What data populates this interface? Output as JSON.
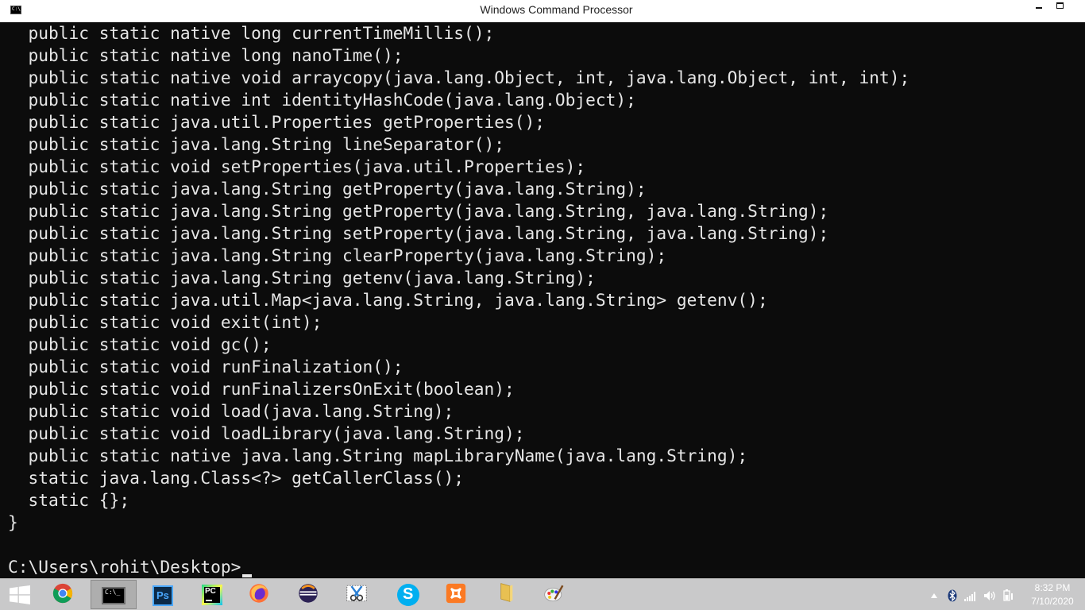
{
  "window": {
    "title": "Windows Command Processor",
    "app_icon_text": "C:\\"
  },
  "console": {
    "lines": [
      "  public static native long currentTimeMillis();",
      "  public static native long nanoTime();",
      "  public static native void arraycopy(java.lang.Object, int, java.lang.Object, int, int);",
      "  public static native int identityHashCode(java.lang.Object);",
      "  public static java.util.Properties getProperties();",
      "  public static java.lang.String lineSeparator();",
      "  public static void setProperties(java.util.Properties);",
      "  public static java.lang.String getProperty(java.lang.String);",
      "  public static java.lang.String getProperty(java.lang.String, java.lang.String);",
      "  public static java.lang.String setProperty(java.lang.String, java.lang.String);",
      "  public static java.lang.String clearProperty(java.lang.String);",
      "  public static java.lang.String getenv(java.lang.String);",
      "  public static java.util.Map<java.lang.String, java.lang.String> getenv();",
      "  public static void exit(int);",
      "  public static void gc();",
      "  public static void runFinalization();",
      "  public static void runFinalizersOnExit(boolean);",
      "  public static void load(java.lang.String);",
      "  public static void loadLibrary(java.lang.String);",
      "  public static native java.lang.String mapLibraryName(java.lang.String);",
      "  static java.lang.Class<?> getCallerClass();",
      "  static {};",
      "}",
      ""
    ],
    "prompt": "C:\\Users\\rohit\\Desktop>"
  },
  "taskbar": {
    "apps": [
      {
        "name": "chrome-icon",
        "active": false
      },
      {
        "name": "command-prompt-icon",
        "active": true,
        "label": "C:\\_"
      },
      {
        "name": "photoshop-icon",
        "active": false,
        "label": "Ps"
      },
      {
        "name": "pycharm-icon",
        "active": false,
        "label": "PC"
      },
      {
        "name": "firefox-icon",
        "active": false
      },
      {
        "name": "eclipse-icon",
        "active": false
      },
      {
        "name": "snipping-tool-icon",
        "active": false
      },
      {
        "name": "skype-icon",
        "active": false,
        "label": "S"
      },
      {
        "name": "xampp-icon",
        "active": false
      },
      {
        "name": "file-explorer-icon",
        "active": false
      },
      {
        "name": "paint-icon",
        "active": false
      }
    ],
    "clock": {
      "time": "8:32 PM",
      "date": "7/10/2020"
    }
  },
  "colors": {
    "console_bg": "#0c0c0c",
    "console_text": "#e6e6e6",
    "taskbar_bg": "#c9c9ca"
  }
}
